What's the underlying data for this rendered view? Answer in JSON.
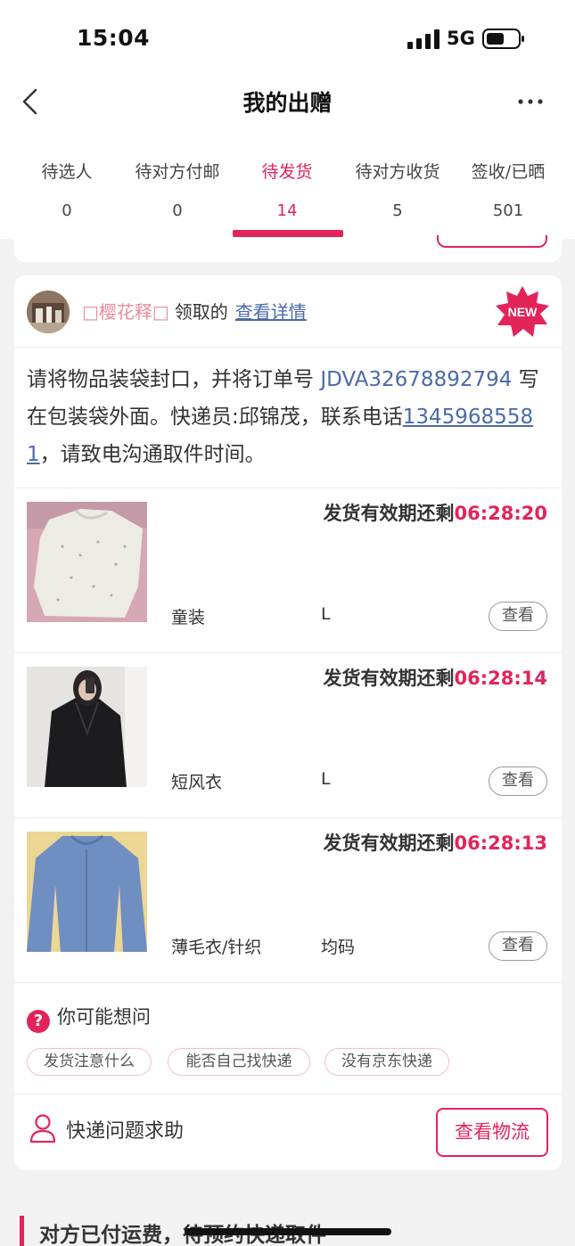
{
  "status": {
    "time": "15:04",
    "network": "5G"
  },
  "nav": {
    "title": "我的出赠"
  },
  "tabs": [
    {
      "label": "待选人",
      "count": "0"
    },
    {
      "label": "待对方付邮",
      "count": "0"
    },
    {
      "label": "待发货",
      "count": "14",
      "active": true
    },
    {
      "label": "待对方收货",
      "count": "5"
    },
    {
      "label": "签收/已晒",
      "count": "501"
    }
  ],
  "card": {
    "nickname": "□樱花释□",
    "claimed_text": "领取的",
    "detail_link": "查看详情",
    "new_badge": "NEW",
    "instruction": {
      "part1": "请将物品装袋封口，并将订单号 ",
      "order_no": "JDVA32678892794",
      "part2": " 写在包装袋外面。快递员:邱锦茂，联系电话",
      "phone": "13459685581",
      "part3": "，请致电沟通取件时间。"
    },
    "items": [
      {
        "deadline_label": "发货有效期还剩",
        "countdown": "06:28:20",
        "name": "童装",
        "size": "L",
        "view_label": "查看"
      },
      {
        "deadline_label": "发货有效期还剩",
        "countdown": "06:28:14",
        "name": "短风衣",
        "size": "L",
        "view_label": "查看"
      },
      {
        "deadline_label": "发货有效期还剩",
        "countdown": "06:28:13",
        "name": "薄毛衣/针织",
        "size": "均码",
        "view_label": "查看"
      }
    ],
    "faq": {
      "title": "你可能想问",
      "chips": [
        "发货注意什么",
        "能否自己找快递",
        "没有京东快递"
      ]
    },
    "help_label": "快递问题求助",
    "logistics_button": "查看物流"
  },
  "section": {
    "title_main": "对方已付运费，",
    "title_strike": "待预约快递取件"
  },
  "colors": {
    "accent": "#e2245a",
    "link": "#4b6aa8"
  }
}
